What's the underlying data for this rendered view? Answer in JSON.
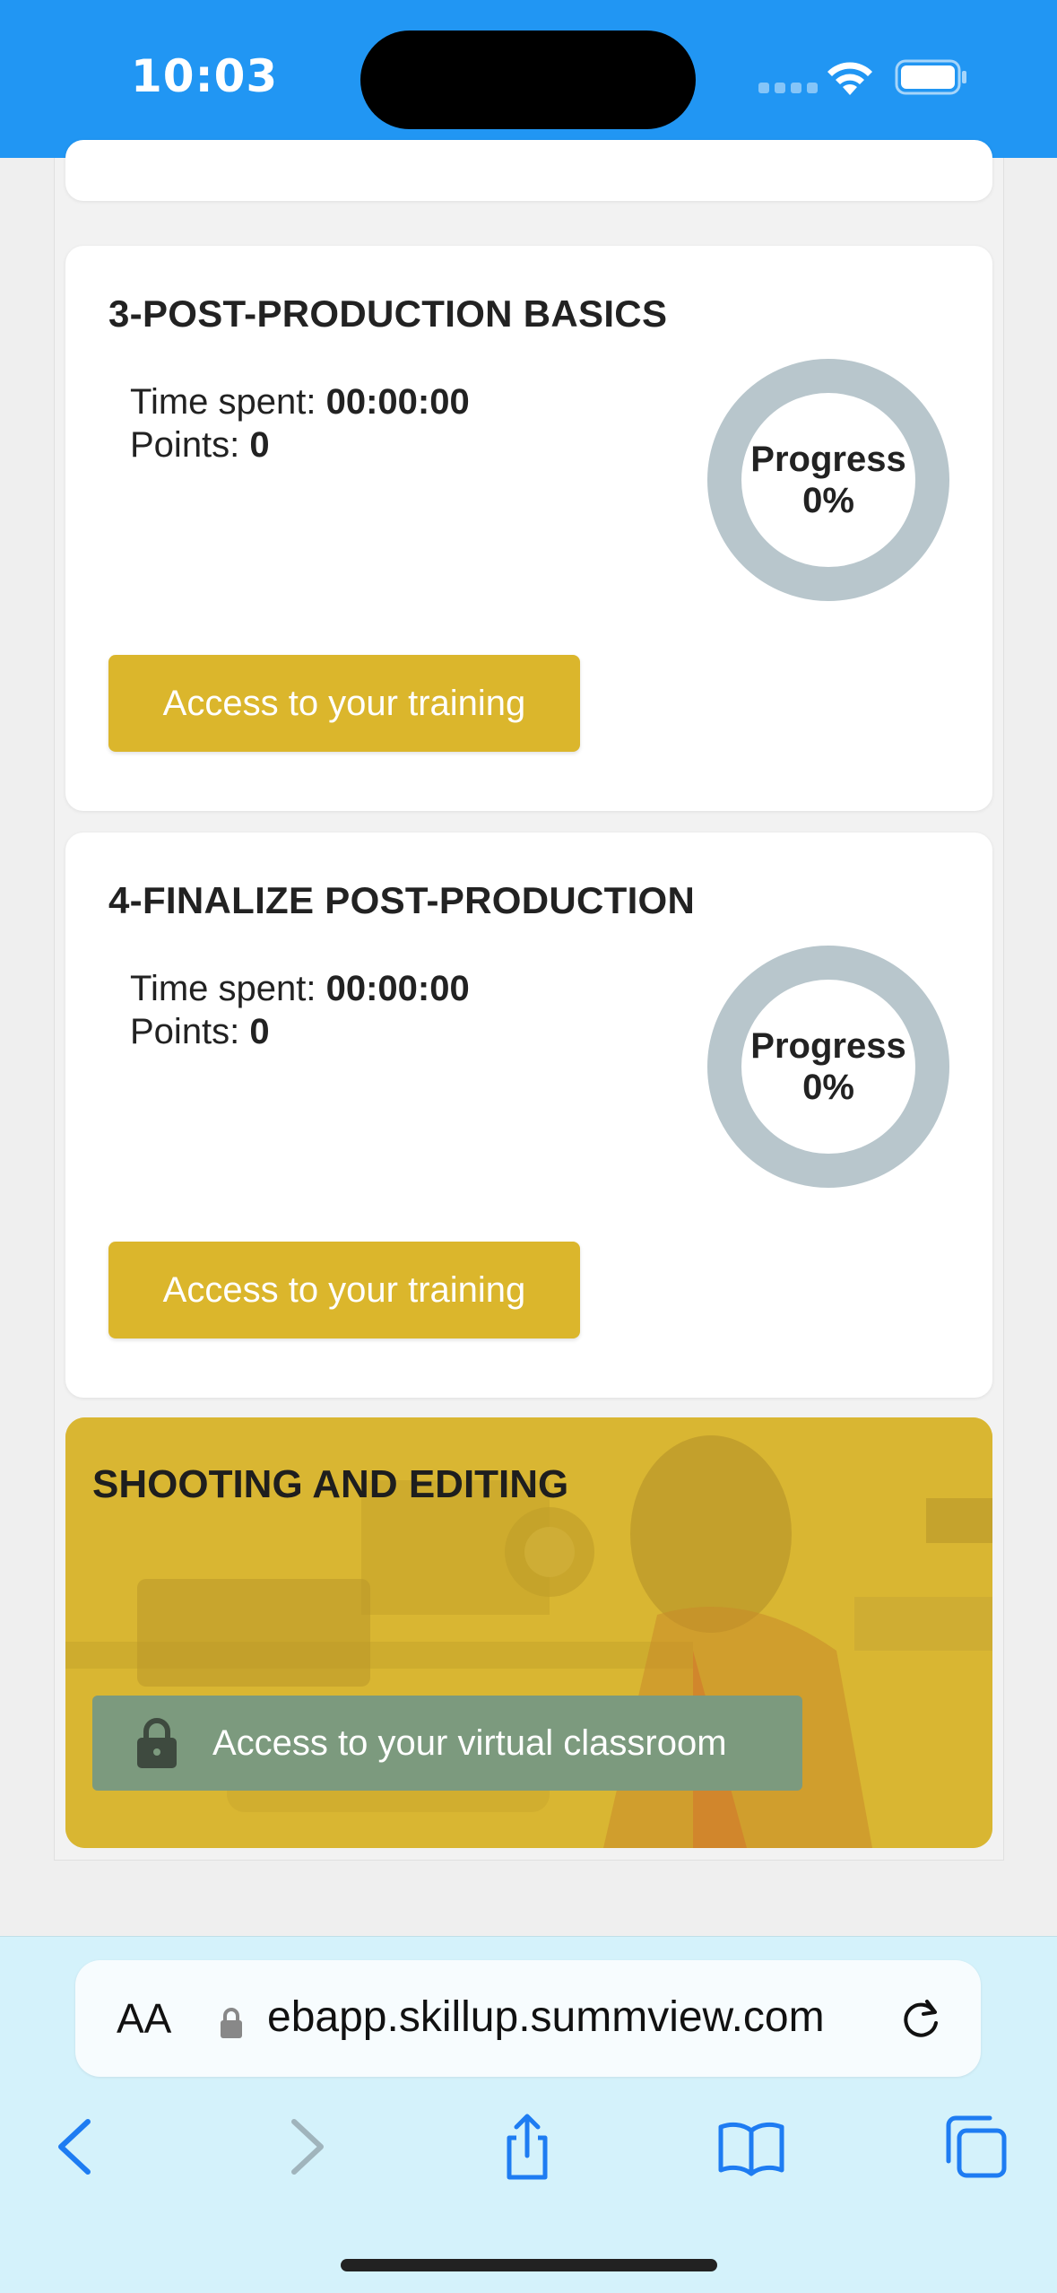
{
  "status_bar": {
    "time": "10:03"
  },
  "trainings": [
    {
      "title": "3-POST-PRODUCTION BASICS",
      "time_label": "Time spent:",
      "time_value": "00:00:00",
      "points_label": "Points:",
      "points_value": "0",
      "progress_label": "Progress",
      "progress_value": "0%",
      "progress_fraction": 0,
      "button": "Access to your training"
    },
    {
      "title": "4-FINALIZE POST-PRODUCTION",
      "time_label": "Time spent:",
      "time_value": "00:00:00",
      "points_label": "Points:",
      "points_value": "0",
      "progress_label": "Progress",
      "progress_value": "0%",
      "progress_fraction": 0,
      "button": "Access to your training"
    }
  ],
  "classroom": {
    "title": "SHOOTING AND EDITING",
    "button": "Access to your virtual classroom",
    "locked": true
  },
  "browser": {
    "text_size_label": "AA",
    "url": "ebapp.skillup.summview.com"
  },
  "colors": {
    "status_bar": "#2196f3",
    "access_button": "#dbb62c",
    "classroom_card": "#d9b632",
    "classroom_button": "#7c9a7e",
    "progress_ring": "#b8c6cc",
    "browser_bar": "#d4f2fb",
    "icon_blue": "#1e7cf2"
  }
}
